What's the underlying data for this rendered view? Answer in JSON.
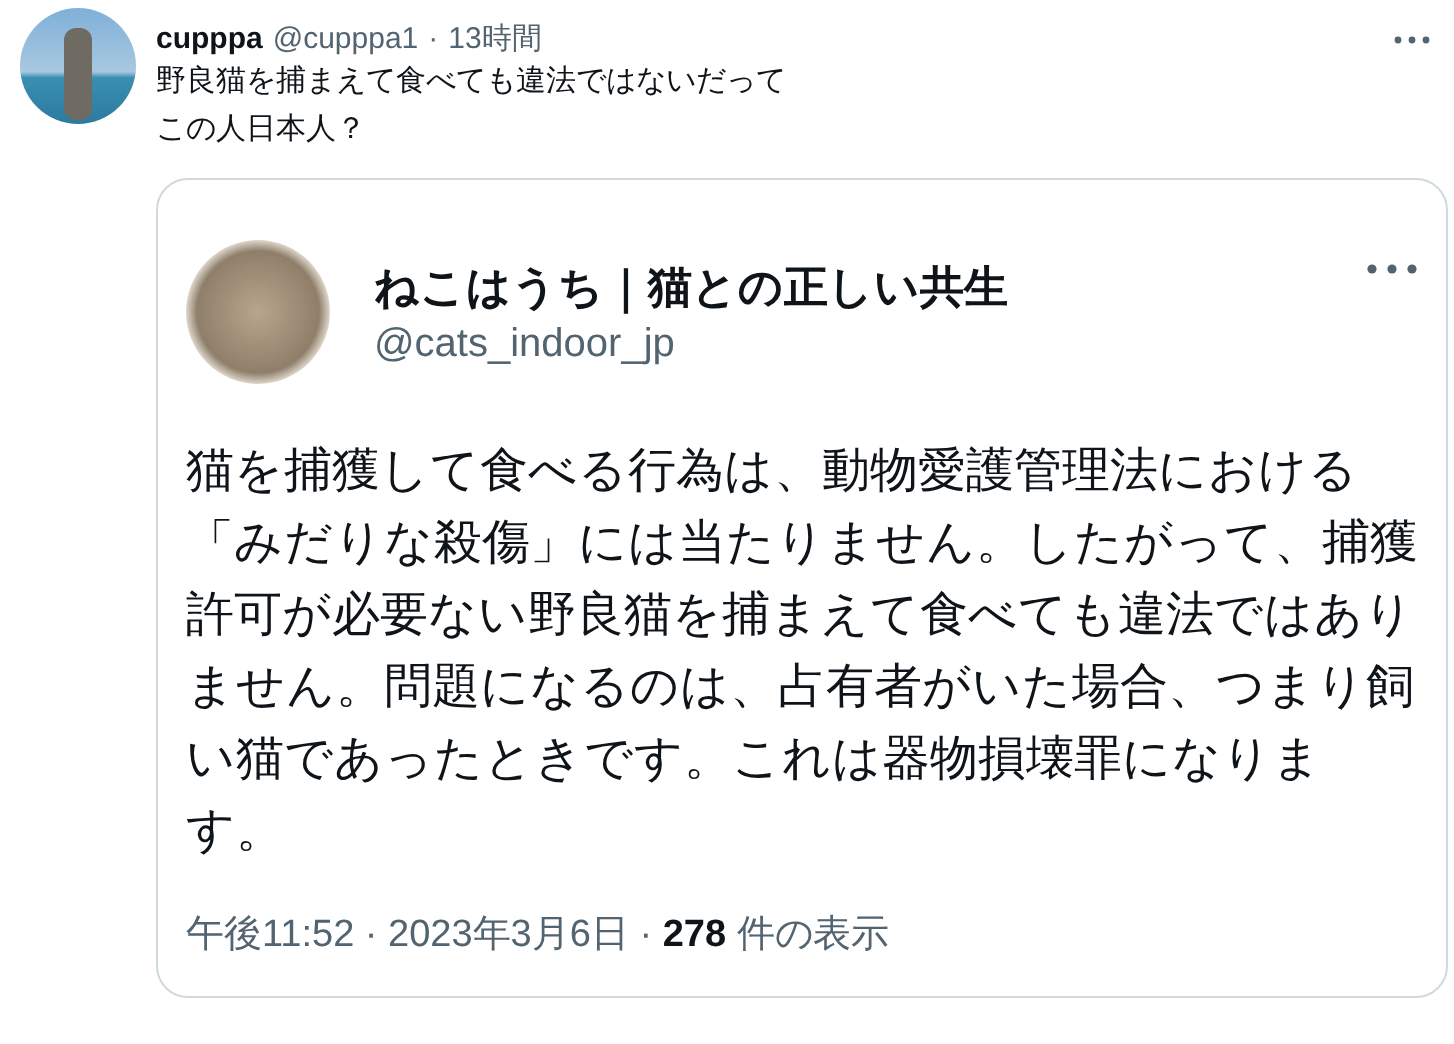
{
  "tweet": {
    "name": "cupppa",
    "handle": "@cupppa1",
    "separator": "·",
    "time": "13時間",
    "lines": [
      "野良猫を捕まえて食べても違法ではないだって",
      "この人日本人？"
    ]
  },
  "quoted_screenshot": {
    "name": "ねこはうち｜猫との正しい共生",
    "handle": "@cats_indoor_jp",
    "body": "猫を捕獲して食べる行為は、動物愛護管理法における「みだりな殺傷」には当たりません。したがって、捕獲許可が必要ない野良猫を捕まえて食べても違法ではありません。問題になるのは、占有者がいた場合、つまり飼い猫であったときです。これは器物損壊罪になります。",
    "meta": "午後11:52 · 2023年3月6日 · **278** 件の表示"
  }
}
